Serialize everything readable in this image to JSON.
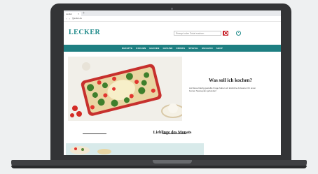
{
  "browser": {
    "tab_title": "Lecker",
    "url": "lecker.de"
  },
  "site": {
    "logo": "LECKER",
    "search_placeholder": "Rezept oder Zutat suchen",
    "menu": [
      "REZEPTE",
      "KOCHEN",
      "BACKEN",
      "GESUND",
      "DRINKS",
      "SPEZIAL",
      "MAGAZIN",
      "SHOP"
    ]
  },
  "hero": {
    "title": "Was soll ich kochen?",
    "subtitle": "Auf diese häufig gestellte Frage haben wir köstliche Antworten für einen bunten Speiseplan gefunden!"
  },
  "favorites": {
    "heading": "Lieblinge des Monats"
  },
  "colors": {
    "brand_teal": "#1e7f82",
    "search_red": "#c8262e"
  }
}
